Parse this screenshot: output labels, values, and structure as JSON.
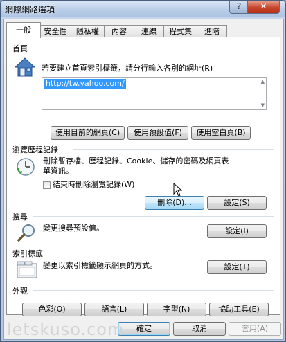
{
  "window": {
    "title": "網際網路選項",
    "help_glyph": "?",
    "close_glyph": "✕"
  },
  "tabs": [
    {
      "label": "一般",
      "active": true
    },
    {
      "label": "安全性"
    },
    {
      "label": "隱私權"
    },
    {
      "label": "內容"
    },
    {
      "label": "連線"
    },
    {
      "label": "程式集"
    },
    {
      "label": "進階"
    }
  ],
  "homepage": {
    "group_title": "首頁",
    "description": "若要建立首頁索引標籤，請分行輸入各別的網址(R)",
    "url_value": "http://tw.yahoo.com/",
    "buttons": {
      "use_current": "使用目前的網頁(C)",
      "use_default": "使用預設值(F)",
      "use_blank": "使用空白頁(B)"
    }
  },
  "history": {
    "group_title": "瀏覽歷程記錄",
    "description_line1": "刪除暫存檔、歷程記錄、Cookie、儲存的密碼及網頁表",
    "description_line2": "單資訊。",
    "checkbox_label": "結束時刪除瀏覽記錄(W)",
    "checkbox_checked": false,
    "delete_button": "刪除(D)...",
    "settings_button": "設定(S)"
  },
  "search": {
    "group_title": "搜尋",
    "description": "變更搜尋預設值。",
    "settings_button": "設定(I)"
  },
  "tabbed": {
    "group_title": "索引標籤",
    "description": "變更以索引標籤顯示網頁的方式。",
    "settings_button": "設定(T)"
  },
  "appearance": {
    "group_title": "外觀",
    "colors_button": "色彩(O)",
    "languages_button": "語言(L)",
    "fonts_button": "字型(N)",
    "accessibility_button": "協助工具(E)"
  },
  "footer": {
    "ok_button": "確定",
    "cancel_button": "取消",
    "apply_button": "套用(A)"
  },
  "watermark": "letskuso.com",
  "colors": {
    "selection": "#3399ff",
    "close_button": "#c8442c"
  }
}
